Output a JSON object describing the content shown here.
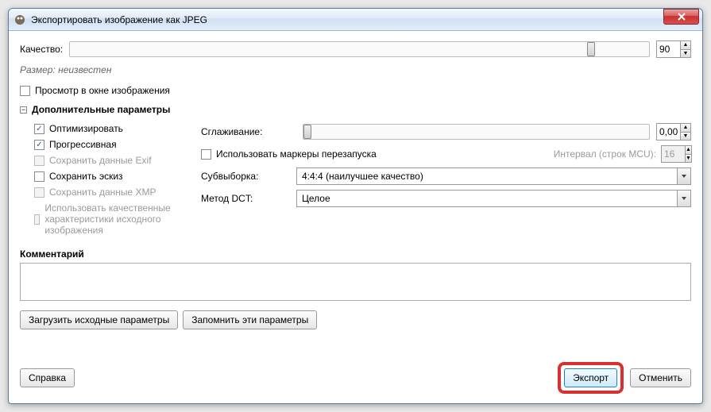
{
  "titlebar": {
    "title": "Экспортировать изображение как JPEG"
  },
  "quality": {
    "label": "Качество:",
    "value": "90",
    "thumb_pct": 90
  },
  "size": {
    "text": "Размер: неизвестен"
  },
  "preview": {
    "label": "Просмотр в окне изображения",
    "checked": false
  },
  "advanced": {
    "title": "Дополнительные параметры",
    "expanded": true,
    "optimize": {
      "label": "Оптимизировать",
      "checked": true
    },
    "progressive": {
      "label": "Прогрессивная",
      "checked": true
    },
    "exif": {
      "label": "Сохранить данные Exif",
      "checked": false,
      "disabled": true
    },
    "thumb": {
      "label": "Сохранить эскиз",
      "checked": false,
      "disabled": false
    },
    "xmp": {
      "label": "Сохранить данные XMP",
      "checked": false,
      "disabled": true
    },
    "use_src_quality": {
      "label": "Использовать качественные характеристики исходного изображения",
      "checked": false,
      "disabled": true
    },
    "smoothing": {
      "label": "Сглаживание:",
      "value": "0,00",
      "thumb_pct": 0
    },
    "restart_markers": {
      "label": "Использовать маркеры перезапуска",
      "checked": false
    },
    "interval": {
      "label": "Интервал (строк MCU):",
      "value": "16",
      "disabled": true
    },
    "subsampling": {
      "label": "Субвыборка:",
      "value": "4:4:4 (наилучшее качество)"
    },
    "dct": {
      "label": "Метод DCT:",
      "value": "Целое"
    }
  },
  "comment": {
    "label": "Комментарий",
    "value": ""
  },
  "buttons": {
    "load_defaults": "Загрузить исходные параметры",
    "save_defaults": "Запомнить эти параметры",
    "help": "Справка",
    "export": "Экспорт",
    "cancel": "Отменить"
  }
}
